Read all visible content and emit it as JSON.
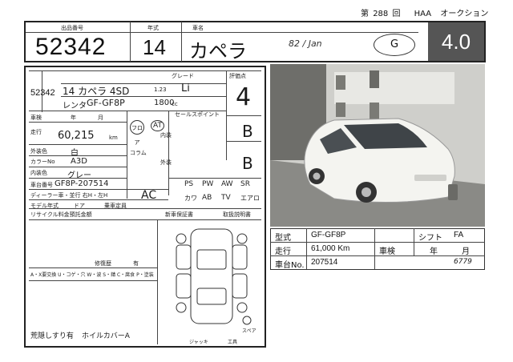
{
  "header": {
    "round_prefix": "第",
    "round_number": "288",
    "round_suffix": "回",
    "auction_house": "HAA",
    "auction_word": "オークション"
  },
  "top_row": {
    "lot_label": "出品番号",
    "lot_number": "52342",
    "year_label": "年式",
    "year": "14",
    "name_label": "車名",
    "car_name": "カペラ",
    "color_note": "82 / Jan",
    "grade_letter": "G",
    "score": "4.0"
  },
  "sheet": {
    "lot_small": "52342",
    "model_line": "14 カペラ 4SD",
    "small_code": "1.23",
    "grade_label": "グレード",
    "grade": "Li",
    "rental": "レンタ",
    "model_code": "GF-GF8P",
    "displacement": "1800",
    "cc_unit": "cc",
    "score_label": "評価点",
    "score_hand": "4",
    "inspection_label": "車検",
    "year_word": "年",
    "month_word": "月",
    "mileage_label": "走行",
    "mileage_hand": "60,215",
    "km_unit": "km",
    "ext_color_label": "外装色",
    "ext_color": "白",
    "color_no_label": "カラーNo",
    "color_no": "A3D",
    "int_color_label": "内装色",
    "int_color": "グレー",
    "chassis_label": "車台番号",
    "chassis_hand": "GF8P-207514",
    "dealer_row": "ディーラー車・並行 右H・左H",
    "model_change_label": "モデル年式",
    "doors_label": "ドア",
    "seats_label": "乗車定員",
    "shift_codes": [
      "フロア",
      "AT",
      "コラム"
    ],
    "ac": "AC",
    "equipment": [
      "PS",
      "PW",
      "AW",
      "SR",
      "カワ",
      "AB",
      "TV",
      "エアロ"
    ],
    "sales_point_label": "セールスポイント",
    "interior_label": "内装",
    "interior_grade": "B",
    "exterior_label": "外装",
    "exterior_grade": "B",
    "recycle_label": "リサイクル料金預託金額",
    "new_car_warranty": "新車保証書",
    "manual_label": "取扱説明書",
    "repair_label": "修復歴",
    "repair_value": "有",
    "legend_line": "A・X要交換 U・コゲ・穴 W・波 S・錆 C・腐食 P・塗装",
    "bottom_note_left": "荒隠しすり有",
    "bottom_note_right": "ホイルカバーA",
    "spare_label": "スペア",
    "jack_label": "ジャッキ",
    "tool_label": "工具"
  },
  "info_table": {
    "rows": [
      {
        "k1": "型式",
        "v1": "GF-GF8P",
        "k2": "シフト",
        "v2": "FA"
      },
      {
        "k1": "走行",
        "v1": "61,000 Km",
        "k2": "車検",
        "v2": "年　　　月"
      },
      {
        "k1": "車台No.",
        "v1": "207514",
        "k2": "",
        "v2": "6779"
      }
    ]
  },
  "photo": {
    "body_color": "#f2f2ee",
    "floor_color": "#7c7c78",
    "wall_color": "#bdbdb8"
  }
}
